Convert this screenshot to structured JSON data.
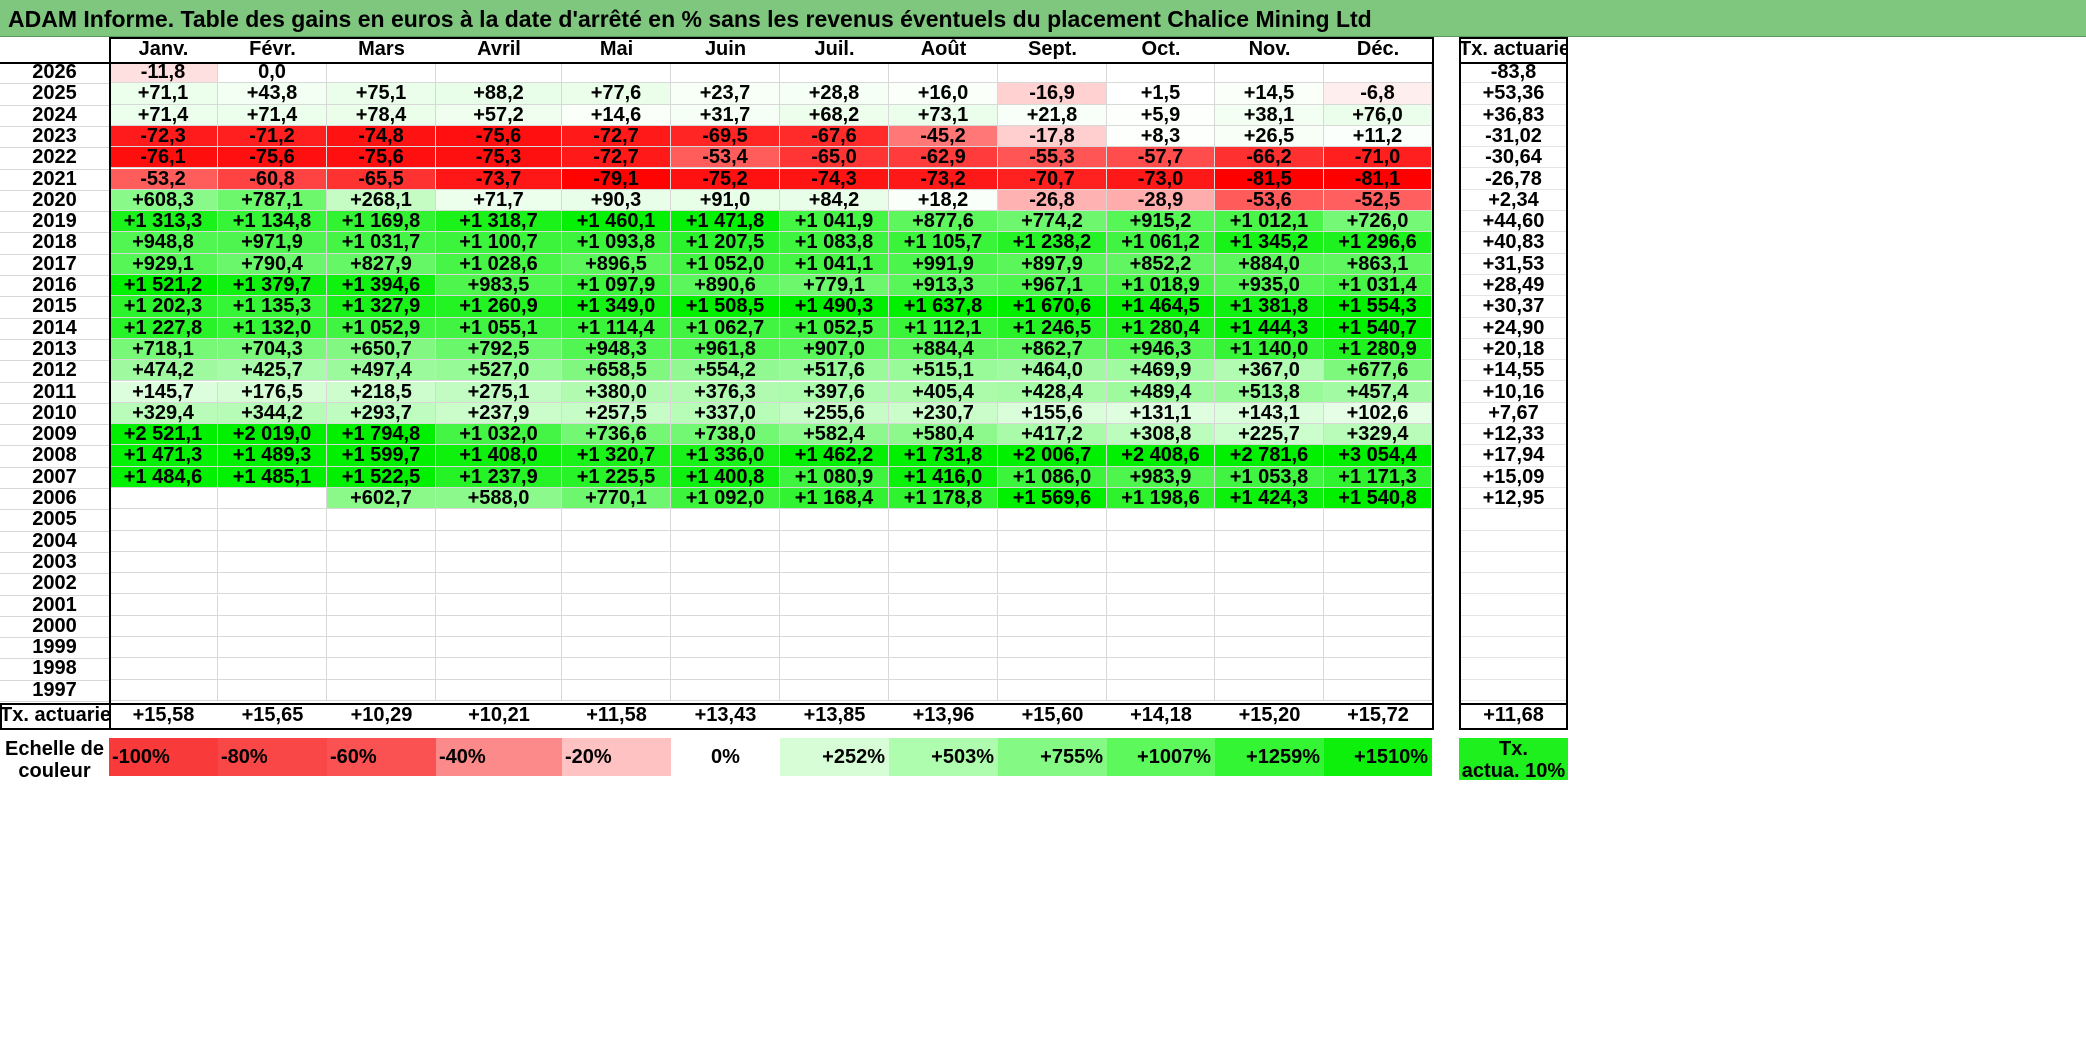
{
  "title": "ADAM Informe. Table des gains en euros à la date d'arrêté en % sans les revenus éventuels du placement Chalice Mining Ltd",
  "months": [
    "Janv.",
    "Févr.",
    "Mars",
    "Avril",
    "Mai",
    "Juin",
    "Juil.",
    "Août",
    "Sept.",
    "Oct.",
    "Nov.",
    "Déc."
  ],
  "tx_header": "Tx. actuariel",
  "rows": [
    {
      "year": "2026",
      "vals": [
        "-11,8",
        "0,0",
        "",
        "",
        "",
        "",
        "",
        "",
        "",
        "",
        "",
        ""
      ],
      "tx": "-83,8"
    },
    {
      "year": "2025",
      "vals": [
        "+71,1",
        "+43,8",
        "+75,1",
        "+88,2",
        "+77,6",
        "+23,7",
        "+28,8",
        "+16,0",
        "-16,9",
        "+1,5",
        "+14,5",
        "-6,8"
      ],
      "tx": "+53,36"
    },
    {
      "year": "2024",
      "vals": [
        "+71,4",
        "+71,4",
        "+78,4",
        "+57,2",
        "+14,6",
        "+31,7",
        "+68,2",
        "+73,1",
        "+21,8",
        "+5,9",
        "+38,1",
        "+76,0"
      ],
      "tx": "+36,83"
    },
    {
      "year": "2023",
      "vals": [
        "-72,3",
        "-71,2",
        "-74,8",
        "-75,6",
        "-72,7",
        "-69,5",
        "-67,6",
        "-45,2",
        "-17,8",
        "+8,3",
        "+26,5",
        "+11,2"
      ],
      "tx": "-31,02"
    },
    {
      "year": "2022",
      "vals": [
        "-76,1",
        "-75,6",
        "-75,6",
        "-75,3",
        "-72,7",
        "-53,4",
        "-65,0",
        "-62,9",
        "-55,3",
        "-57,7",
        "-66,2",
        "-71,0"
      ],
      "tx": "-30,64"
    },
    {
      "year": "2021",
      "vals": [
        "-53,2",
        "-60,8",
        "-65,5",
        "-73,7",
        "-79,1",
        "-75,2",
        "-74,3",
        "-73,2",
        "-70,7",
        "-73,0",
        "-81,5",
        "-81,1"
      ],
      "tx": "-26,78"
    },
    {
      "year": "2020",
      "vals": [
        "+608,3",
        "+787,1",
        "+268,1",
        "+71,7",
        "+90,3",
        "+91,0",
        "+84,2",
        "+18,2",
        "-26,8",
        "-28,9",
        "-53,6",
        "-52,5"
      ],
      "tx": "+2,34"
    },
    {
      "year": "2019",
      "vals": [
        "+1 313,3",
        "+1 134,8",
        "+1 169,8",
        "+1 318,7",
        "+1 460,1",
        "+1 471,8",
        "+1 041,9",
        "+877,6",
        "+774,2",
        "+915,2",
        "+1 012,1",
        "+726,0"
      ],
      "tx": "+44,60"
    },
    {
      "year": "2018",
      "vals": [
        "+948,8",
        "+971,9",
        "+1 031,7",
        "+1 100,7",
        "+1 093,8",
        "+1 207,5",
        "+1 083,8",
        "+1 105,7",
        "+1 238,2",
        "+1 061,2",
        "+1 345,2",
        "+1 296,6"
      ],
      "tx": "+40,83"
    },
    {
      "year": "2017",
      "vals": [
        "+929,1",
        "+790,4",
        "+827,9",
        "+1 028,6",
        "+896,5",
        "+1 052,0",
        "+1 041,1",
        "+991,9",
        "+897,9",
        "+852,2",
        "+884,0",
        "+863,1"
      ],
      "tx": "+31,53"
    },
    {
      "year": "2016",
      "vals": [
        "+1 521,2",
        "+1 379,7",
        "+1 394,6",
        "+983,5",
        "+1 097,9",
        "+890,6",
        "+779,1",
        "+913,3",
        "+967,1",
        "+1 018,9",
        "+935,0",
        "+1 031,4"
      ],
      "tx": "+28,49"
    },
    {
      "year": "2015",
      "vals": [
        "+1 202,3",
        "+1 135,3",
        "+1 327,9",
        "+1 260,9",
        "+1 349,0",
        "+1 508,5",
        "+1 490,3",
        "+1 637,8",
        "+1 670,6",
        "+1 464,5",
        "+1 381,8",
        "+1 554,3"
      ],
      "tx": "+30,37"
    },
    {
      "year": "2014",
      "vals": [
        "+1 227,8",
        "+1 132,0",
        "+1 052,9",
        "+1 055,1",
        "+1 114,4",
        "+1 062,7",
        "+1 052,5",
        "+1 112,1",
        "+1 246,5",
        "+1 280,4",
        "+1 444,3",
        "+1 540,7"
      ],
      "tx": "+24,90"
    },
    {
      "year": "2013",
      "vals": [
        "+718,1",
        "+704,3",
        "+650,7",
        "+792,5",
        "+948,3",
        "+961,8",
        "+907,0",
        "+884,4",
        "+862,7",
        "+946,3",
        "+1 140,0",
        "+1 280,9"
      ],
      "tx": "+20,18"
    },
    {
      "year": "2012",
      "vals": [
        "+474,2",
        "+425,7",
        "+497,4",
        "+527,0",
        "+658,5",
        "+554,2",
        "+517,6",
        "+515,1",
        "+464,0",
        "+469,9",
        "+367,0",
        "+677,6"
      ],
      "tx": "+14,55"
    },
    {
      "year": "2011",
      "vals": [
        "+145,7",
        "+176,5",
        "+218,5",
        "+275,1",
        "+380,0",
        "+376,3",
        "+397,6",
        "+405,4",
        "+428,4",
        "+489,4",
        "+513,8",
        "+457,4"
      ],
      "tx": "+10,16"
    },
    {
      "year": "2010",
      "vals": [
        "+329,4",
        "+344,2",
        "+293,7",
        "+237,9",
        "+257,5",
        "+337,0",
        "+255,6",
        "+230,7",
        "+155,6",
        "+131,1",
        "+143,1",
        "+102,6"
      ],
      "tx": "+7,67"
    },
    {
      "year": "2009",
      "vals": [
        "+2 521,1",
        "+2 019,0",
        "+1 794,8",
        "+1 032,0",
        "+736,6",
        "+738,0",
        "+582,4",
        "+580,4",
        "+417,2",
        "+308,8",
        "+225,7",
        "+329,4"
      ],
      "tx": "+12,33"
    },
    {
      "year": "2008",
      "vals": [
        "+1 471,3",
        "+1 489,3",
        "+1 599,7",
        "+1 408,0",
        "+1 320,7",
        "+1 336,0",
        "+1 462,2",
        "+1 731,8",
        "+2 006,7",
        "+2 408,6",
        "+2 781,6",
        "+3 054,4"
      ],
      "tx": "+17,94"
    },
    {
      "year": "2007",
      "vals": [
        "+1 484,6",
        "+1 485,1",
        "+1 522,5",
        "+1 237,9",
        "+1 225,5",
        "+1 400,8",
        "+1 080,9",
        "+1 416,0",
        "+1 086,0",
        "+983,9",
        "+1 053,8",
        "+1 171,3"
      ],
      "tx": "+15,09"
    },
    {
      "year": "2006",
      "vals": [
        "",
        "",
        "+602,7",
        "+588,0",
        "+770,1",
        "+1 092,0",
        "+1 168,4",
        "+1 178,8",
        "+1 569,6",
        "+1 198,6",
        "+1 424,3",
        "+1 540,8"
      ],
      "tx": "+12,95"
    },
    {
      "year": "2005",
      "vals": [
        "",
        "",
        "",
        "",
        "",
        "",
        "",
        "",
        "",
        "",
        "",
        ""
      ],
      "tx": ""
    },
    {
      "year": "2004",
      "vals": [
        "",
        "",
        "",
        "",
        "",
        "",
        "",
        "",
        "",
        "",
        "",
        ""
      ],
      "tx": ""
    },
    {
      "year": "2003",
      "vals": [
        "",
        "",
        "",
        "",
        "",
        "",
        "",
        "",
        "",
        "",
        "",
        ""
      ],
      "tx": ""
    },
    {
      "year": "2002",
      "vals": [
        "",
        "",
        "",
        "",
        "",
        "",
        "",
        "",
        "",
        "",
        "",
        ""
      ],
      "tx": ""
    },
    {
      "year": "2001",
      "vals": [
        "",
        "",
        "",
        "",
        "",
        "",
        "",
        "",
        "",
        "",
        "",
        ""
      ],
      "tx": ""
    },
    {
      "year": "2000",
      "vals": [
        "",
        "",
        "",
        "",
        "",
        "",
        "",
        "",
        "",
        "",
        "",
        ""
      ],
      "tx": ""
    },
    {
      "year": "1999",
      "vals": [
        "",
        "",
        "",
        "",
        "",
        "",
        "",
        "",
        "",
        "",
        "",
        ""
      ],
      "tx": ""
    },
    {
      "year": "1998",
      "vals": [
        "",
        "",
        "",
        "",
        "",
        "",
        "",
        "",
        "",
        "",
        "",
        ""
      ],
      "tx": ""
    },
    {
      "year": "1997",
      "vals": [
        "",
        "",
        "",
        "",
        "",
        "",
        "",
        "",
        "",
        "",
        "",
        ""
      ],
      "tx": ""
    }
  ],
  "footer": {
    "label": "Tx. actuariel",
    "vals": [
      "+15,58",
      "+15,65",
      "+10,29",
      "+10,21",
      "+11,58",
      "+13,43",
      "+13,85",
      "+13,96",
      "+15,60",
      "+14,18",
      "+15,20",
      "+15,72"
    ],
    "tx": "+11,68"
  },
  "scale": {
    "label_line1": "Echelle de",
    "label_line2": "couleur",
    "items": [
      {
        "text": "-100%",
        "color": "#f83a3a",
        "align": "left"
      },
      {
        "text": "-80%",
        "color": "#f94646",
        "align": "left"
      },
      {
        "text": "-60%",
        "color": "#fa5252",
        "align": "left"
      },
      {
        "text": "-40%",
        "color": "#fc8a8a",
        "align": "left"
      },
      {
        "text": "-20%",
        "color": "#fec2c2",
        "align": "left"
      },
      {
        "text": "0%",
        "color": "#ffffff",
        "align": "center"
      },
      {
        "text": "+252%",
        "color": "#d6fdd6",
        "align": "right"
      },
      {
        "text": "+503%",
        "color": "#aefcae",
        "align": "right"
      },
      {
        "text": "+755%",
        "color": "#84fa84",
        "align": "right"
      },
      {
        "text": "+1007%",
        "color": "#5cf85c",
        "align": "right"
      },
      {
        "text": "+1259%",
        "color": "#34f534",
        "align": "right"
      },
      {
        "text": "+1510%",
        "color": "#0cf00c",
        "align": "right"
      }
    ],
    "tx_line1": "Tx.",
    "tx_line2": "actua. 10%",
    "tx_color": "#1df01d"
  }
}
